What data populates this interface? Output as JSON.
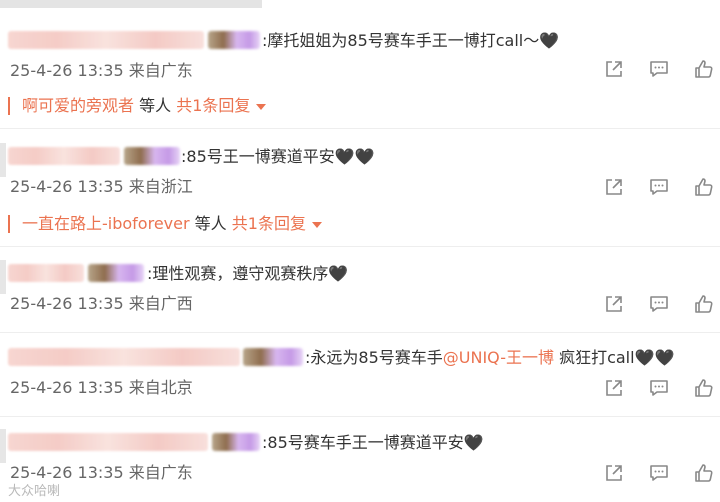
{
  "comments": [
    {
      "text": ":摩托姐姐为85号赛车手王一博打call～",
      "hearts": "🖤",
      "time": "25-4-26 13:35",
      "location": "来自广东",
      "reply": {
        "name": "啊可爱的旁观者",
        "mid": "等人",
        "count": "共1条回复"
      }
    },
    {
      "text": ":85号王一博赛道平安",
      "hearts": "🖤🖤",
      "time": "25-4-26 13:35",
      "location": "来自浙江",
      "reply": {
        "name": "一直在路上-iboforever",
        "mid": "等人",
        "count": "共1条回复"
      }
    },
    {
      "text": ":理性观赛，遵守观赛秩序",
      "hearts": "🖤",
      "time": "25-4-26 13:35",
      "location": "来自广西"
    },
    {
      "text_before": ":永远为85号赛车手",
      "mention": "@UNIQ-王一博",
      "text_after": " 疯狂打call",
      "hearts": "🖤🖤",
      "time": "25-4-26 13:35",
      "location": "来自北京"
    },
    {
      "text": ":85号赛车手王一博赛道平安",
      "hearts": "🖤",
      "time": "25-4-26 13:35",
      "location": "来自广东"
    }
  ],
  "icons": {
    "share": "share-icon",
    "comment": "comment-icon",
    "like": "like-icon"
  },
  "colors": {
    "accent": "#eb7350",
    "meta": "#666666",
    "icon": "#888888"
  },
  "watermark": "大众哈喇"
}
